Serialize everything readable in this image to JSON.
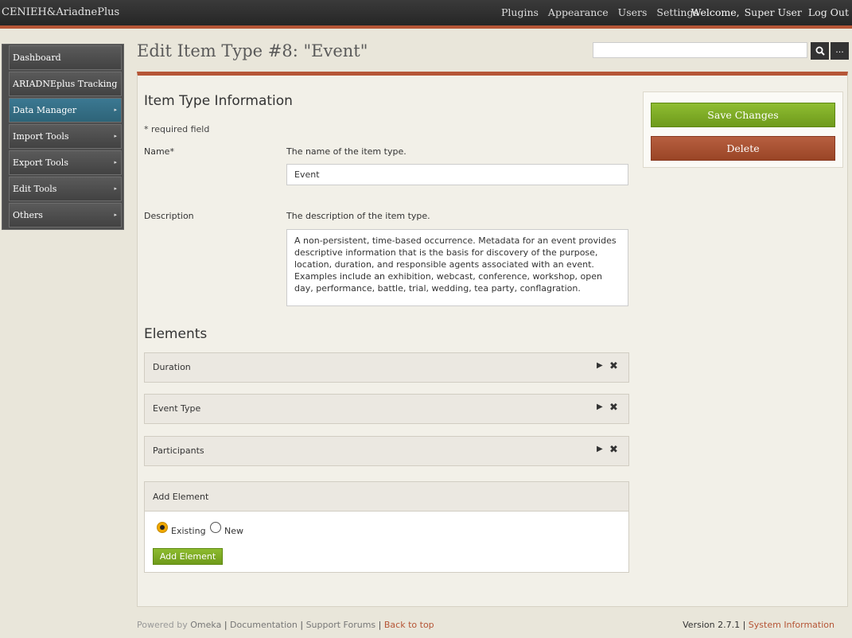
{
  "site_title": "CENIEH&AriadnePlus",
  "global_nav": [
    "Plugins",
    "Appearance",
    "Users",
    "Settings"
  ],
  "user_nav": {
    "welcome": "Welcome,",
    "user": "Super User",
    "logout": "Log Out"
  },
  "sidebar": {
    "items": [
      {
        "label": "Dashboard",
        "has_arrow": false,
        "active": false
      },
      {
        "label": "ARIADNEplus Tracking",
        "has_arrow": false,
        "active": false
      },
      {
        "label": "Data Manager",
        "has_arrow": true,
        "active": true
      },
      {
        "label": "Import Tools",
        "has_arrow": true,
        "active": false
      },
      {
        "label": "Export Tools",
        "has_arrow": true,
        "active": false
      },
      {
        "label": "Edit Tools",
        "has_arrow": true,
        "active": false
      },
      {
        "label": "Others",
        "has_arrow": true,
        "active": false
      }
    ],
    "arrow_glyph": "▸"
  },
  "page_title": "Edit Item Type #8: \"Event\"",
  "search": {
    "value": "",
    "button_icon": "search-icon",
    "advanced_label": "..."
  },
  "form": {
    "section_title": "Item Type Information",
    "required_note": "* required field",
    "name": {
      "label": "Name*",
      "help": "The name of the item type.",
      "value": "Event"
    },
    "description": {
      "label": "Description",
      "help": "The description of the item type.",
      "value": "A non-persistent, time-based occurrence. Metadata for an event provides descriptive information that is the basis for discovery of the purpose, location, duration, and responsible agents associated with an event. Examples include an exhibition, webcast, conference, workshop, open day, performance, battle, trial, wedding, tea party, conflagration."
    }
  },
  "elements": {
    "title": "Elements",
    "items": [
      {
        "name": "Duration"
      },
      {
        "name": "Event Type"
      },
      {
        "name": "Participants"
      }
    ],
    "expand_glyph": "▶",
    "remove_glyph": "✖",
    "add": {
      "title": "Add Element",
      "options": [
        {
          "label": "Existing",
          "checked": true
        },
        {
          "label": "New",
          "checked": false
        }
      ],
      "button_label": "Add Element"
    }
  },
  "actions": {
    "save_label": "Save Changes",
    "delete_label": "Delete"
  },
  "footer": {
    "powered_by": "Powered by",
    "omeka": "Omeka",
    "sep": "|",
    "documentation": "Documentation",
    "support_forums": "Support Forums",
    "back_to_top": "Back to top",
    "version": "Version 2.7.1",
    "system_info": "System Information"
  },
  "colors": {
    "accent": "#b55536",
    "save": "#7aa824",
    "delete": "#a04b2c",
    "active_nav": "#346e86"
  }
}
